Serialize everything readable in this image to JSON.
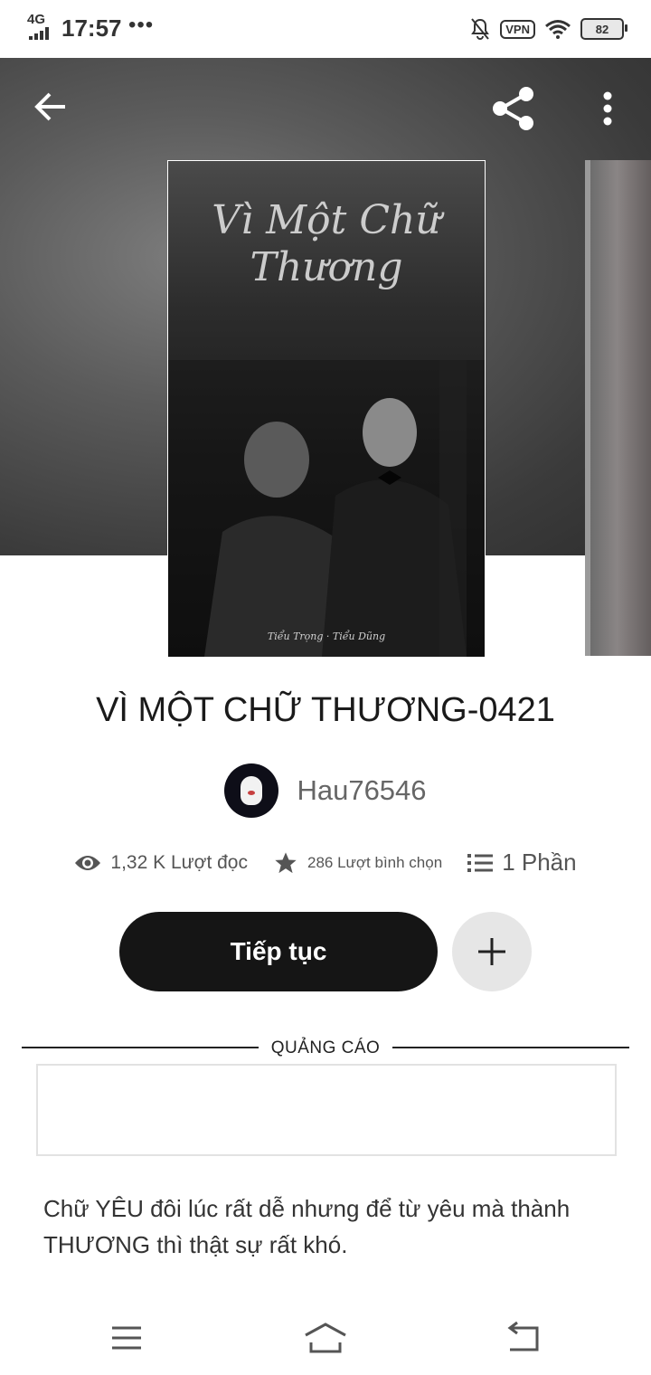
{
  "status_bar": {
    "network": "4G",
    "time": "17:57",
    "dots": "•••",
    "vpn": "VPN",
    "battery": "82"
  },
  "cover": {
    "title_art": "Vì Một Chữ Thương",
    "signature": "Tiểu Trọng · Tiểu Dũng"
  },
  "story": {
    "title": "VÌ MỘT CHỮ THƯƠNG-0421",
    "author": "Hau76546",
    "reads": "1,32 K Lượt đọc",
    "votes": "286 Lượt bình chọn",
    "parts": "1 Phần",
    "continue_label": "Tiếp tục",
    "add_label": "+",
    "description": "Chữ YÊU đôi lúc rất dễ nhưng để từ yêu mà thành THƯƠNG thì thật sự rất khó."
  },
  "ad": {
    "label": "QUẢNG CÁO"
  },
  "icons": {
    "back": "arrow-left-icon",
    "share": "share-icon",
    "more": "more-vertical-icon",
    "views": "eye-icon",
    "votes": "star-icon",
    "parts": "list-icon",
    "add": "plus-icon"
  }
}
